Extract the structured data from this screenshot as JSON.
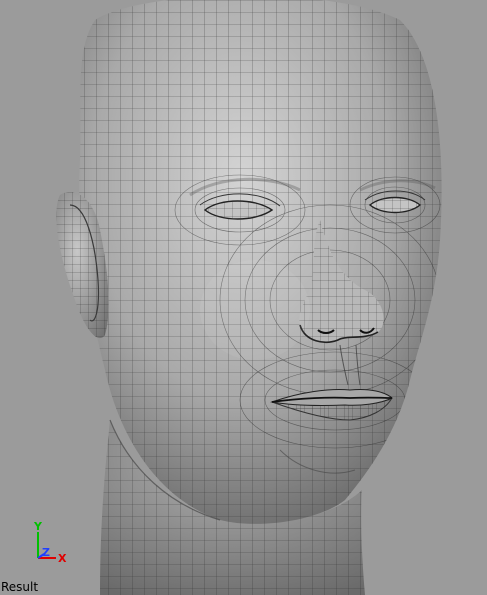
{
  "viewport": {
    "view_label": "Result",
    "background_color": "#9b9b9b",
    "mesh_color": "#7a7a7a",
    "wire_color": "#2a2a2a"
  },
  "axis_gizmo": {
    "y_label": "Y",
    "x_label": "X",
    "z_label": "Z",
    "y_color": "#00c000",
    "x_color": "#e00000",
    "z_color": "#2040ff"
  }
}
